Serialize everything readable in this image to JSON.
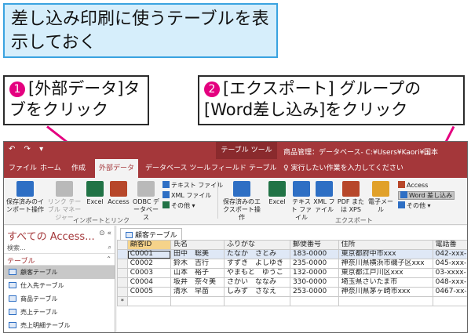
{
  "title_callout": "差し込み印刷に使うテーブルを表示しておく",
  "step1": {
    "num": "❶",
    "text": "[外部データ]タブをクリック"
  },
  "step2": {
    "num": "❷",
    "text": "[エクスポート] グループの[Word差し込み]をクリック"
  },
  "titlebar": {
    "quick_access": "↶ ↷ ▾",
    "context_tools": "テーブル ツール",
    "doc_title": "商品管理：データベース- C:¥Users¥Kaori¥...",
    "user": "国本"
  },
  "tabs": {
    "file": "ファイル",
    "home": "ホーム",
    "create": "作成",
    "external": "外部データ",
    "dbtools": "データベース ツール",
    "fields": "フィールド",
    "table": "テーブル",
    "tell_me": "実行したい作業を入力してください"
  },
  "ribbon": {
    "saved_import": "保存済みのインポート操作",
    "linked_table": "リンク テーブル マネージャー",
    "excel": "Excel",
    "access": "Access",
    "odbc": "ODBC データベース",
    "text_file": "テキスト ファイル",
    "xml_file": "XML ファイル",
    "other_import": "その他",
    "import_group": "インポートとリンク",
    "saved_export": "保存済みのエクスポート操作",
    "excel_exp": "Excel",
    "text_exp": "テキスト ファイル",
    "xml_exp": "XML ファイル",
    "pdf_xps": "PDF または XPS",
    "email": "電子メール",
    "access_exp": "Access",
    "word_merge": "Word 差し込み",
    "other_export": "その他",
    "export_group": "エクスポート"
  },
  "nav": {
    "header": "すべての Access...",
    "header_ctl": "⊙ «",
    "search": "検索...",
    "section": "テーブル",
    "section_ctl": "⌃",
    "items": [
      "顧客テーブル",
      "仕入先テーブル",
      "商品テーブル",
      "売上テーブル",
      "売上明細テーブル"
    ]
  },
  "table": {
    "tab": "顧客テーブル",
    "columns": [
      "顧客ID",
      "氏名",
      "ふりがな",
      "郵便番号",
      "住所",
      "電話番"
    ],
    "rows": [
      [
        "C0001",
        "田中　聡美",
        "たなか　さとみ",
        "183-0000",
        "東京都府中市xxx",
        "042-xxx-"
      ],
      [
        "C0002",
        "鈴木　吉行",
        "すずき　よしゆき",
        "235-0000",
        "神奈川県横浜市磯子区xxx",
        "045-xxx-"
      ],
      [
        "C0003",
        "山本　裕子",
        "やまもと　ゆうこ",
        "132-0000",
        "東京都江戸川区xxx",
        "03-xxxx-"
      ],
      [
        "C0004",
        "坂井　奈々美",
        "さかい　ななみ",
        "330-0000",
        "埼玉県さいたま市",
        "048-xxx-"
      ],
      [
        "C0005",
        "清水　早苗",
        "しみず　さなえ",
        "253-0000",
        "神奈川県茅ヶ崎市xxx",
        "0467-xx-"
      ]
    ],
    "new_row_marker": "*"
  },
  "accent_color": "#a4373a",
  "pointer_color": "#e4007f"
}
